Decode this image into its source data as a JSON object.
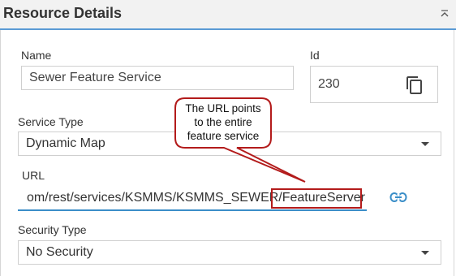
{
  "header": {
    "title": "Resource Details",
    "collapse_icon": "chevron-up-icon"
  },
  "name_field": {
    "label": "Name",
    "value": "Sewer Feature Service"
  },
  "id_field": {
    "label": "Id",
    "value": "230",
    "copy_icon": "copy-icon"
  },
  "service_type": {
    "label": "Service Type",
    "value": "Dynamic Map"
  },
  "url_field": {
    "label": "URL",
    "value": "om/rest/services/KSMMS/KSMMS_SEWER/FeatureServer",
    "link_icon": "link-icon"
  },
  "security_type": {
    "label": "Security Type",
    "value": "No Security"
  },
  "callout": {
    "text_lines": [
      "The URL points",
      "to the entire",
      "feature service"
    ]
  },
  "colors": {
    "accent": "#3b8ec8",
    "callout_border": "#b31b1b",
    "header_bg": "#f2f2f2"
  }
}
